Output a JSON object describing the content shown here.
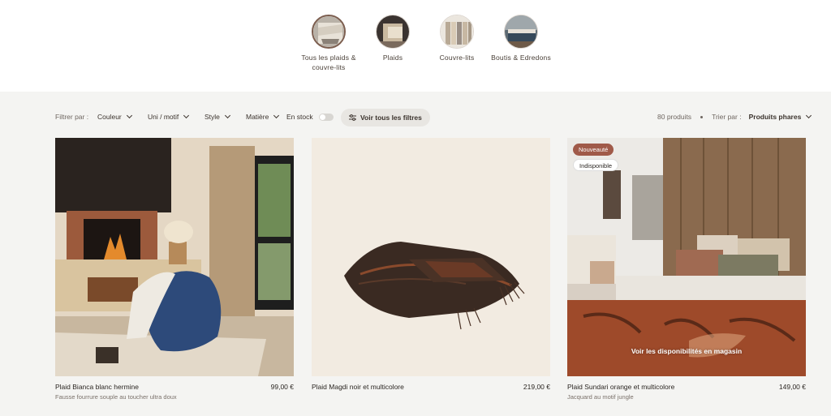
{
  "categories": [
    {
      "label": "Tous les plaids & couvre-lits",
      "active": true
    },
    {
      "label": "Plaids",
      "active": false
    },
    {
      "label": "Couvre-lits",
      "active": false
    },
    {
      "label": "Boutis & Edredons",
      "active": false
    }
  ],
  "filters": {
    "filter_by": "Filtrer par :",
    "color": "Couleur",
    "pattern": "Uni / motif",
    "style": "Style",
    "material": "Matière",
    "in_stock": "En stock",
    "all_filters": "Voir tous les filtres",
    "count": "80 produits",
    "sort_by": "Trier par :",
    "sort_value": "Produits phares"
  },
  "products": [
    {
      "name": "Plaid Bianca blanc hermine",
      "price": "99,00 €",
      "subtitle": "Fausse fourrure souple au toucher ultra doux"
    },
    {
      "name": "Plaid Magdi noir et multicolore",
      "price": "219,00 €",
      "subtitle": ""
    },
    {
      "name": "Plaid Sundari orange et multicolore",
      "price": "149,00 €",
      "subtitle": "Jacquard au motif jungle",
      "badge_new": "Nouveauté",
      "badge_unavailable": "Indisponible",
      "store_link": "Voir les disponibilités en magasin"
    }
  ],
  "colors": {
    "accent": "#a05a49",
    "background_listing": "#f4f4f2",
    "text": "#2b2622"
  }
}
